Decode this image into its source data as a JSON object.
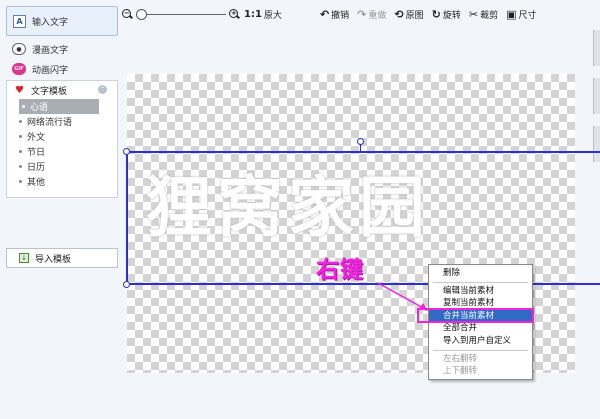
{
  "sidebar": {
    "items": [
      {
        "label": "输入文字",
        "icon": "text-input-icon"
      },
      {
        "label": "漫画文字",
        "icon": "comic-text-icon"
      },
      {
        "label": "动画闪字",
        "icon": "gif-animation-icon"
      }
    ],
    "templates": {
      "title": "文字模板",
      "items": [
        "心语",
        "网络流行语",
        "外文",
        "节日",
        "日历",
        "其他"
      ],
      "selected": "心语"
    },
    "import_label": "导入模板"
  },
  "toolbar": {
    "zoom_ratio": "1:1",
    "original_size": "原大",
    "undo": "撤销",
    "redo": "重做",
    "original_image": "原图",
    "rotate": "旋转",
    "crop": "裁剪",
    "size": "尺寸"
  },
  "canvas": {
    "text": "狸窝家园",
    "annotation": "右键"
  },
  "context_menu": {
    "items": [
      "删除",
      "编辑当前素材",
      "复制当前素材",
      "合并当前素材",
      "全部合并",
      "导入到用户自定义",
      "左右翻转",
      "上下翻转"
    ],
    "highlighted": "合并当前素材",
    "disabled": [
      "左右翻转",
      "上下翻转"
    ]
  },
  "colors": {
    "selection": "#2e2ed6",
    "annotation": "#f024e0",
    "menu_highlight": "#316ac5"
  }
}
